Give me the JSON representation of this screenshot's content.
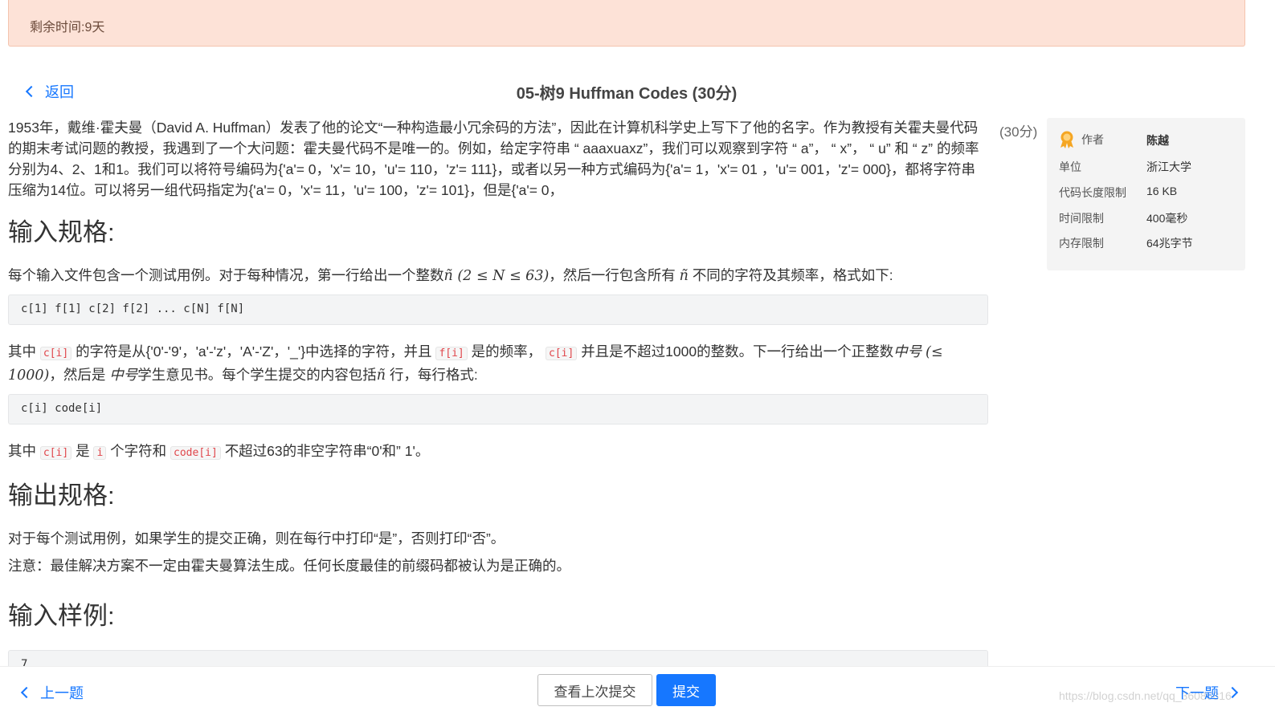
{
  "banner": {
    "text": "剩余时间:9天"
  },
  "nav": {
    "back_label": "返回",
    "title": "05-树9 Huffman Codes (30分)"
  },
  "problem": {
    "intro": "1953年，戴维·霍夫曼（David A. Huffman）发表了他的论文“一种构造最小冗余码的方法”，因此在计算机科学史上写下了他的名字。作为教授有关霍夫曼代码的期末考试问题的教授，我遇到了一个大问题：霍夫曼代码不是唯一的。例如，给定字符串 “ aaaxuaxz”，我们可以观察到字符 “ a”， “ x”， “ u” 和 “ z” 的频率分别为4、2、1和1。我们可以将符号编码为{'a'= 0，'x'= 10，'u'= 110，'z'= 111}，或者以另一种方式编码为{'a'= 1，'x'= 01 ，'u'= 001，'z'= 000}，都将字符串压缩为14位。可以将另一组代码指定为{'a'= 0，'x'= 11，'u'= 100，'z'= 101}，但是{'a'= 0，",
    "input_heading": "输入规格:",
    "input_p1_a": "每个输入文件包含一个测试用例。对于每种情况，第一行给出一个整数",
    "input_p1_math": "ñ (2 ≤ N ≤ 63)",
    "input_p1_b": "，然后一行包含所有",
    "input_p1_math2": "ñ",
    "input_p1_c": "不同的字符及其频率，格式如下:",
    "code1": "c[1] f[1] c[2] f[2] ... c[N] f[N]",
    "input_p2_a": "其中",
    "input_p2_code1": "c[i]",
    "input_p2_b": "的字符是从{'0'-'9'，'a'-'z'，'A'-'Z'，'_'}中选择的字符，并且",
    "input_p2_code2": "f[i]",
    "input_p2_c": "是的频率，",
    "input_p2_code3": "c[i]",
    "input_p2_d": "并且是不超过1000的整数。下一行给出一个正整数",
    "input_p2_math1": "中号",
    "input_p2_math2": "(≤ 1000)",
    "input_p2_e": "，然后是",
    "input_p2_math3": "中号",
    "input_p2_f": "学生意见书。每个学生提交的内容包括",
    "input_p2_math4": "ñ",
    "input_p2_g": "行，每行格式:",
    "code2": "c[i] code[i]",
    "input_p3_a": "其中",
    "input_p3_code1": "c[i]",
    "input_p3_b": "是",
    "input_p3_code2": "i",
    "input_p3_c": "个字符和",
    "input_p3_code3": "code[i]",
    "input_p3_d": "不超过63的非空字符串“0'和” 1'。",
    "output_heading": "输出规格:",
    "output_p1": "对于每个测试用例，如果学生的提交正确，则在每行中打印“是”，否则打印“否”。",
    "output_p2": "注意：最佳解决方案不一定由霍夫曼算法生成。任何长度最佳的前缀码都被认为是正确的。",
    "sample_heading": "输入样例:",
    "sample_first_line": "7"
  },
  "score": "(30分)",
  "info": [
    {
      "label": "作者",
      "value": "陈越"
    },
    {
      "label": "单位",
      "value": "浙江大学"
    },
    {
      "label": "代码长度限制",
      "value": "16 KB"
    },
    {
      "label": "时间限制",
      "value": "400毫秒"
    },
    {
      "label": "内存限制",
      "value": "64兆字节"
    }
  ],
  "footer": {
    "prev_label": "上一题",
    "view_last_label": "查看上次提交",
    "submit_label": "提交",
    "next_label": "下一题",
    "watermark": "https://blog.csdn.net/qq_36086816"
  },
  "colors": {
    "accent": "#1677ff",
    "banner_bg": "#fde2d7",
    "code_red": "#e0464b"
  }
}
